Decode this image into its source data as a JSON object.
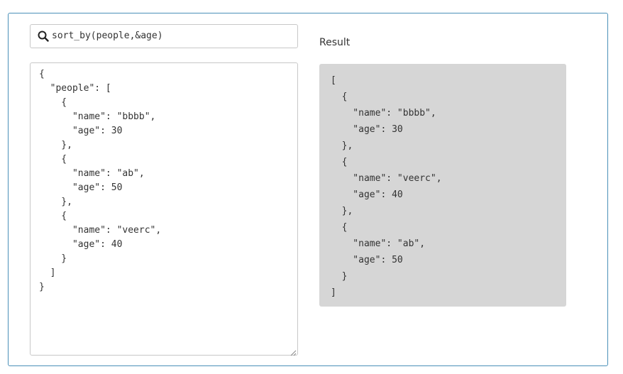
{
  "query": {
    "value": "sort_by(people,&age)",
    "icon": "search-icon"
  },
  "input_json": "{\n  \"people\": [\n    {\n      \"name\": \"bbbb\",\n      \"age\": 30\n    },\n    {\n      \"name\": \"ab\",\n      \"age\": 50\n    },\n    {\n      \"name\": \"veerc\",\n      \"age\": 40\n    }\n  ]\n}",
  "result": {
    "heading": "Result",
    "text": "[\n  {\n    \"name\": \"bbbb\",\n    \"age\": 30\n  },\n  {\n    \"name\": \"veerc\",\n    \"age\": 40\n  },\n  {\n    \"name\": \"ab\",\n    \"age\": 50\n  }\n]"
  },
  "colors": {
    "frame_border": "#4a90b8",
    "result_background": "#d6d6d6"
  }
}
